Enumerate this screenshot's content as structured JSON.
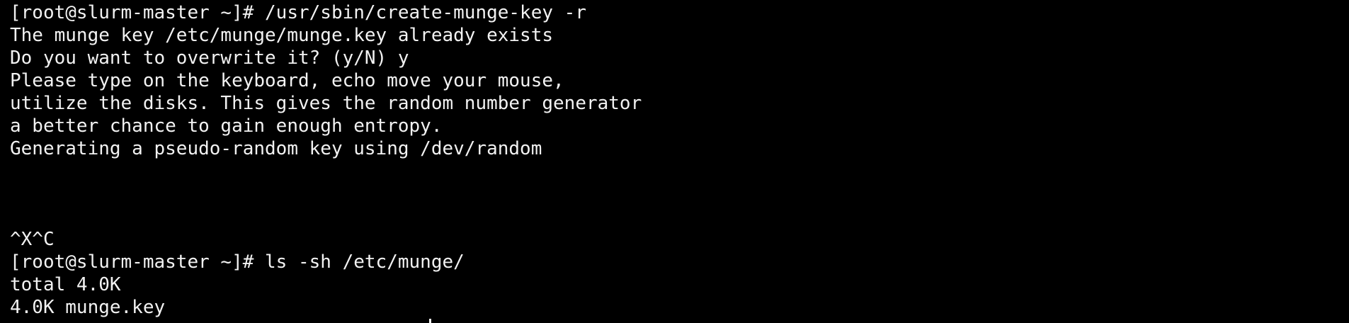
{
  "colors": {
    "background": "#000000",
    "foreground": "#f2f2f2"
  },
  "terminal": {
    "lines": [
      "[root@slurm-master ~]# /usr/sbin/create-munge-key -r",
      "The munge key /etc/munge/munge.key already exists",
      "Do you want to overwrite it? (y/N) y",
      "Please type on the keyboard, echo move your mouse,",
      "utilize the disks. This gives the random number generator",
      "a better chance to gain enough entropy.",
      "Generating a pseudo-random key using /dev/random",
      "",
      "",
      "",
      "^X^C",
      "[root@slurm-master ~]# ls -sh /etc/munge/",
      "total 4.0K",
      "4.0K munge.key"
    ]
  }
}
